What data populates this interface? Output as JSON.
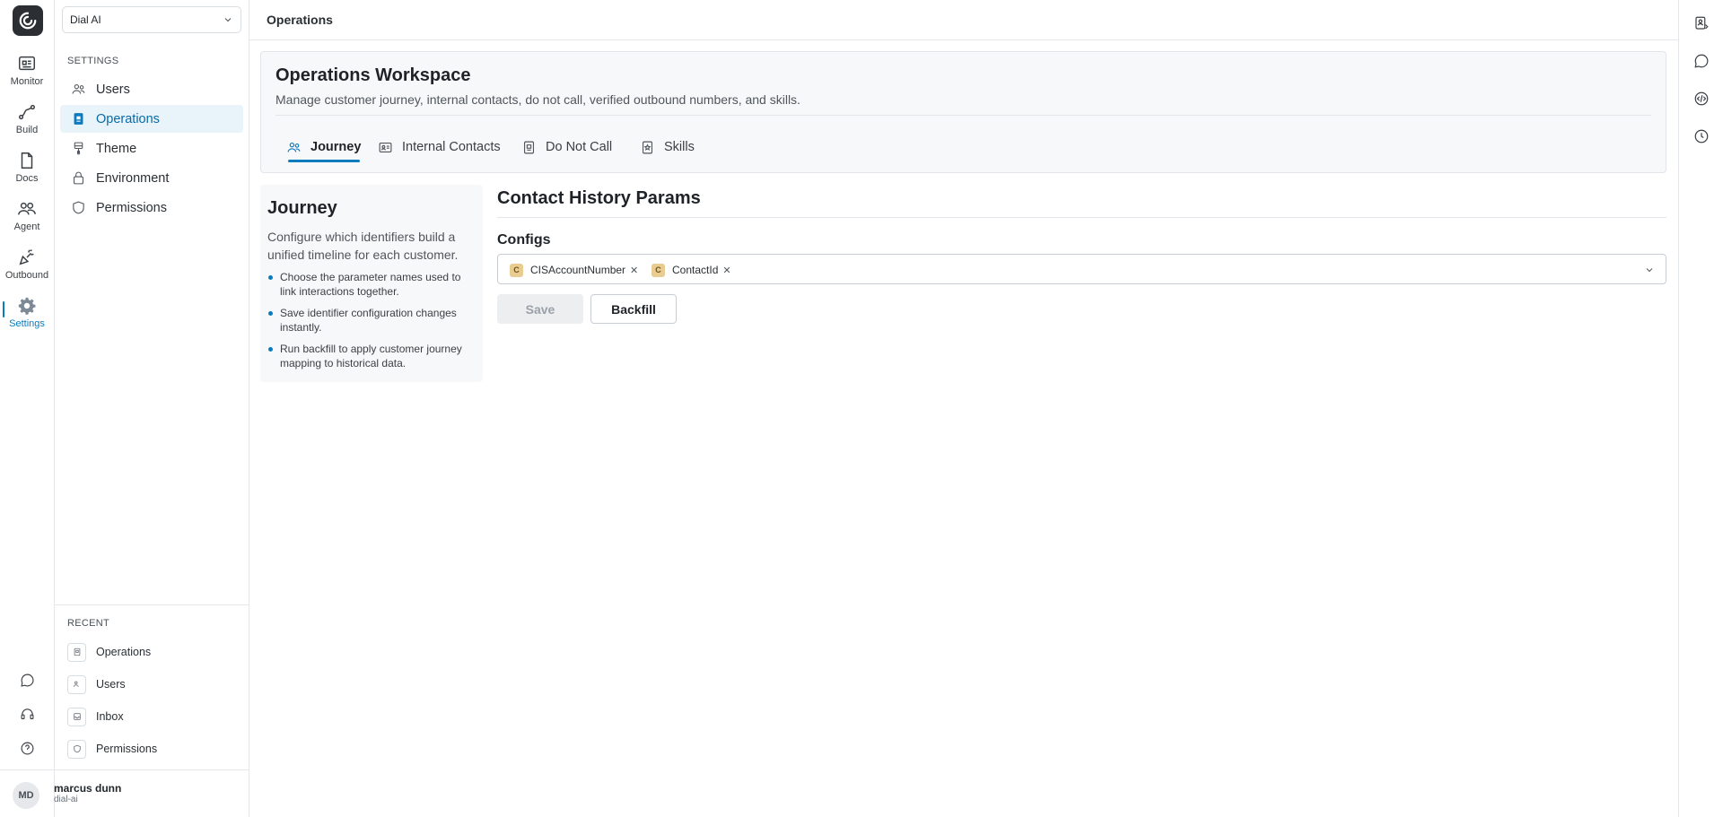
{
  "rail": {
    "items": [
      {
        "label": "Monitor",
        "icon": "monitor-icon"
      },
      {
        "label": "Build",
        "icon": "build-icon"
      },
      {
        "label": "Docs",
        "icon": "docs-icon"
      },
      {
        "label": "Agent",
        "icon": "agent-icon"
      },
      {
        "label": "Outbound",
        "icon": "outbound-icon"
      },
      {
        "label": "Settings",
        "icon": "settings-icon",
        "active": true
      }
    ],
    "bottom_icons": [
      "chat-icon",
      "headset-icon",
      "help-icon"
    ]
  },
  "sidebar": {
    "org_select": "Dial AI",
    "section_label": "SETTINGS",
    "items": [
      {
        "label": "Users",
        "icon": "users-icon"
      },
      {
        "label": "Operations",
        "icon": "operations-icon",
        "active": true
      },
      {
        "label": "Theme",
        "icon": "theme-icon"
      },
      {
        "label": "Environment",
        "icon": "lock-icon"
      },
      {
        "label": "Permissions",
        "icon": "shield-icon"
      }
    ],
    "recent_label": "RECENT",
    "recent": [
      {
        "label": "Operations"
      },
      {
        "label": "Users"
      },
      {
        "label": "Inbox"
      },
      {
        "label": "Permissions"
      }
    ],
    "user": {
      "initials": "MD",
      "name": "marcus dunn",
      "handle": "dial-ai"
    }
  },
  "topbar": {
    "title": "Operations"
  },
  "workspace": {
    "title": "Operations Workspace",
    "description": "Manage customer journey, internal contacts, do not call, verified outbound numbers, and skills.",
    "tabs": [
      {
        "label": "Journey",
        "active": true
      },
      {
        "label": "Internal Contacts"
      },
      {
        "label": "Do Not Call"
      },
      {
        "label": "Skills"
      }
    ]
  },
  "journey": {
    "title": "Journey",
    "description": "Configure which identifiers build a unified timeline for each customer.",
    "bullets": [
      "Choose the parameter names used to link interactions together.",
      "Save identifier configuration changes instantly.",
      "Run backfill to apply customer journey mapping to historical data."
    ]
  },
  "contact_history": {
    "title": "Contact History Params",
    "configs_label": "Configs",
    "chips": [
      {
        "badge": "C",
        "label": "CISAccountNumber"
      },
      {
        "badge": "C",
        "label": "ContactId"
      }
    ],
    "save_label": "Save",
    "backfill_label": "Backfill"
  },
  "colors": {
    "accent": "#0a7bbf",
    "chip_badge": "#e8cc92"
  }
}
